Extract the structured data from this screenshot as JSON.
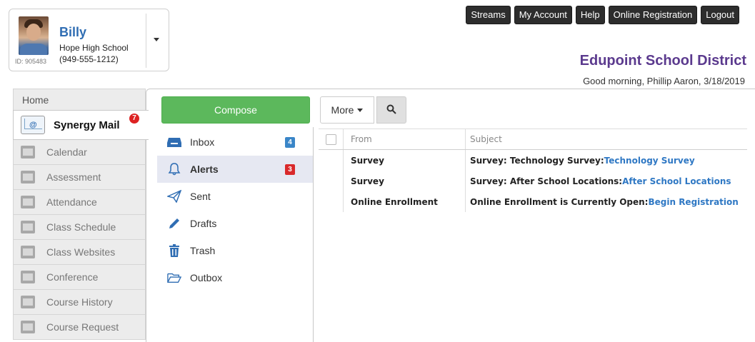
{
  "profile": {
    "name": "Billy",
    "school": "Hope High School",
    "id_label": "ID: 905483",
    "phone": "(949-555-1212)"
  },
  "top_nav": {
    "buttons": [
      "Streams",
      "My Account",
      "Help",
      "Online Registration",
      "Logout"
    ]
  },
  "header": {
    "district": "Edupoint School District",
    "greeting": "Good morning, Phillip Aaron, 3/18/2019"
  },
  "left_nav": {
    "home": "Home",
    "active": {
      "label": "Synergy Mail",
      "badge": "7"
    },
    "items": [
      {
        "label": "Calendar",
        "icon": "calendar-icon"
      },
      {
        "label": "Assessment",
        "icon": "assessment-icon"
      },
      {
        "label": "Attendance",
        "icon": "attendance-icon"
      },
      {
        "label": "Class Schedule",
        "icon": "class-schedule-icon"
      },
      {
        "label": "Class Websites",
        "icon": "class-websites-icon"
      },
      {
        "label": "Conference",
        "icon": "conference-icon"
      },
      {
        "label": "Course History",
        "icon": "course-history-icon"
      },
      {
        "label": "Course Request",
        "icon": "course-request-icon"
      }
    ]
  },
  "mail": {
    "compose_label": "Compose",
    "more_label": "More",
    "folders": [
      {
        "label": "Inbox",
        "badge": "4",
        "icon": "inbox-icon"
      },
      {
        "label": "Alerts",
        "badge": "3",
        "icon": "bell-icon"
      },
      {
        "label": "Sent",
        "badge": "",
        "icon": "paper-plane-icon"
      },
      {
        "label": "Drafts",
        "badge": "",
        "icon": "pencil-icon"
      },
      {
        "label": "Trash",
        "badge": "",
        "icon": "trash-icon"
      },
      {
        "label": "Outbox",
        "badge": "",
        "icon": "folder-open-icon"
      }
    ],
    "table": {
      "columns": [
        "From",
        "Subject"
      ],
      "rows": [
        {
          "from": "Survey",
          "subject": "Survey: Technology Survey: ",
          "link": "Technology Survey"
        },
        {
          "from": "Survey",
          "subject": "Survey: After School Locations: ",
          "link": "After School Locations"
        },
        {
          "from": "Online Enrollment",
          "subject": "Online Enrollment is Currently Open: ",
          "link": "Begin Registration"
        }
      ]
    }
  },
  "colors": {
    "compose_green": "#5cb85c",
    "district_purple": "#5b3a8e",
    "link_blue": "#2f78c4",
    "badge_red": "#d9292b",
    "badge_blue": "#3a86c8"
  }
}
